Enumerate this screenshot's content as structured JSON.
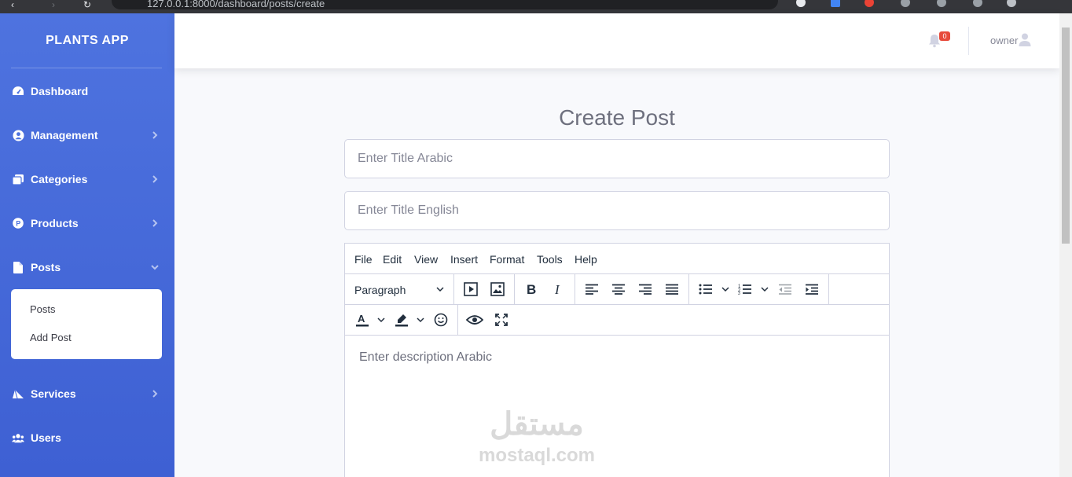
{
  "browser": {
    "url": "127.0.0.1:8000/dashboard/posts/create"
  },
  "sidebar": {
    "brand": "PLANTS APP",
    "items": [
      {
        "label": "Dashboard",
        "icon": "tachometer-icon"
      },
      {
        "label": "Management",
        "icon": "user-circle-icon"
      },
      {
        "label": "Categories",
        "icon": "copy-icon"
      },
      {
        "label": "Products",
        "icon": "product-p-icon"
      },
      {
        "label": "Posts",
        "icon": "file-icon"
      },
      {
        "label": "Services",
        "icon": "services-icon"
      },
      {
        "label": "Users",
        "icon": "users-icon"
      }
    ],
    "posts_submenu": [
      "Posts",
      "Add Post"
    ]
  },
  "topbar": {
    "notification_count": "0",
    "user_name": "owner"
  },
  "main": {
    "title": "Create Post",
    "title_arabic_placeholder": "Enter Title Arabic",
    "title_english_placeholder": "Enter Title English",
    "editor": {
      "menu": [
        "File",
        "Edit",
        "View",
        "Insert",
        "Format",
        "Tools",
        "Help"
      ],
      "block_format": "Paragraph",
      "placeholder": "Enter description Arabic"
    }
  },
  "watermark": {
    "arabic": "مستقل",
    "latin": "mostaql.com"
  },
  "colors": {
    "sidebar": "#4e73df",
    "badge": "#e74a3b",
    "text_muted": "#858796"
  }
}
